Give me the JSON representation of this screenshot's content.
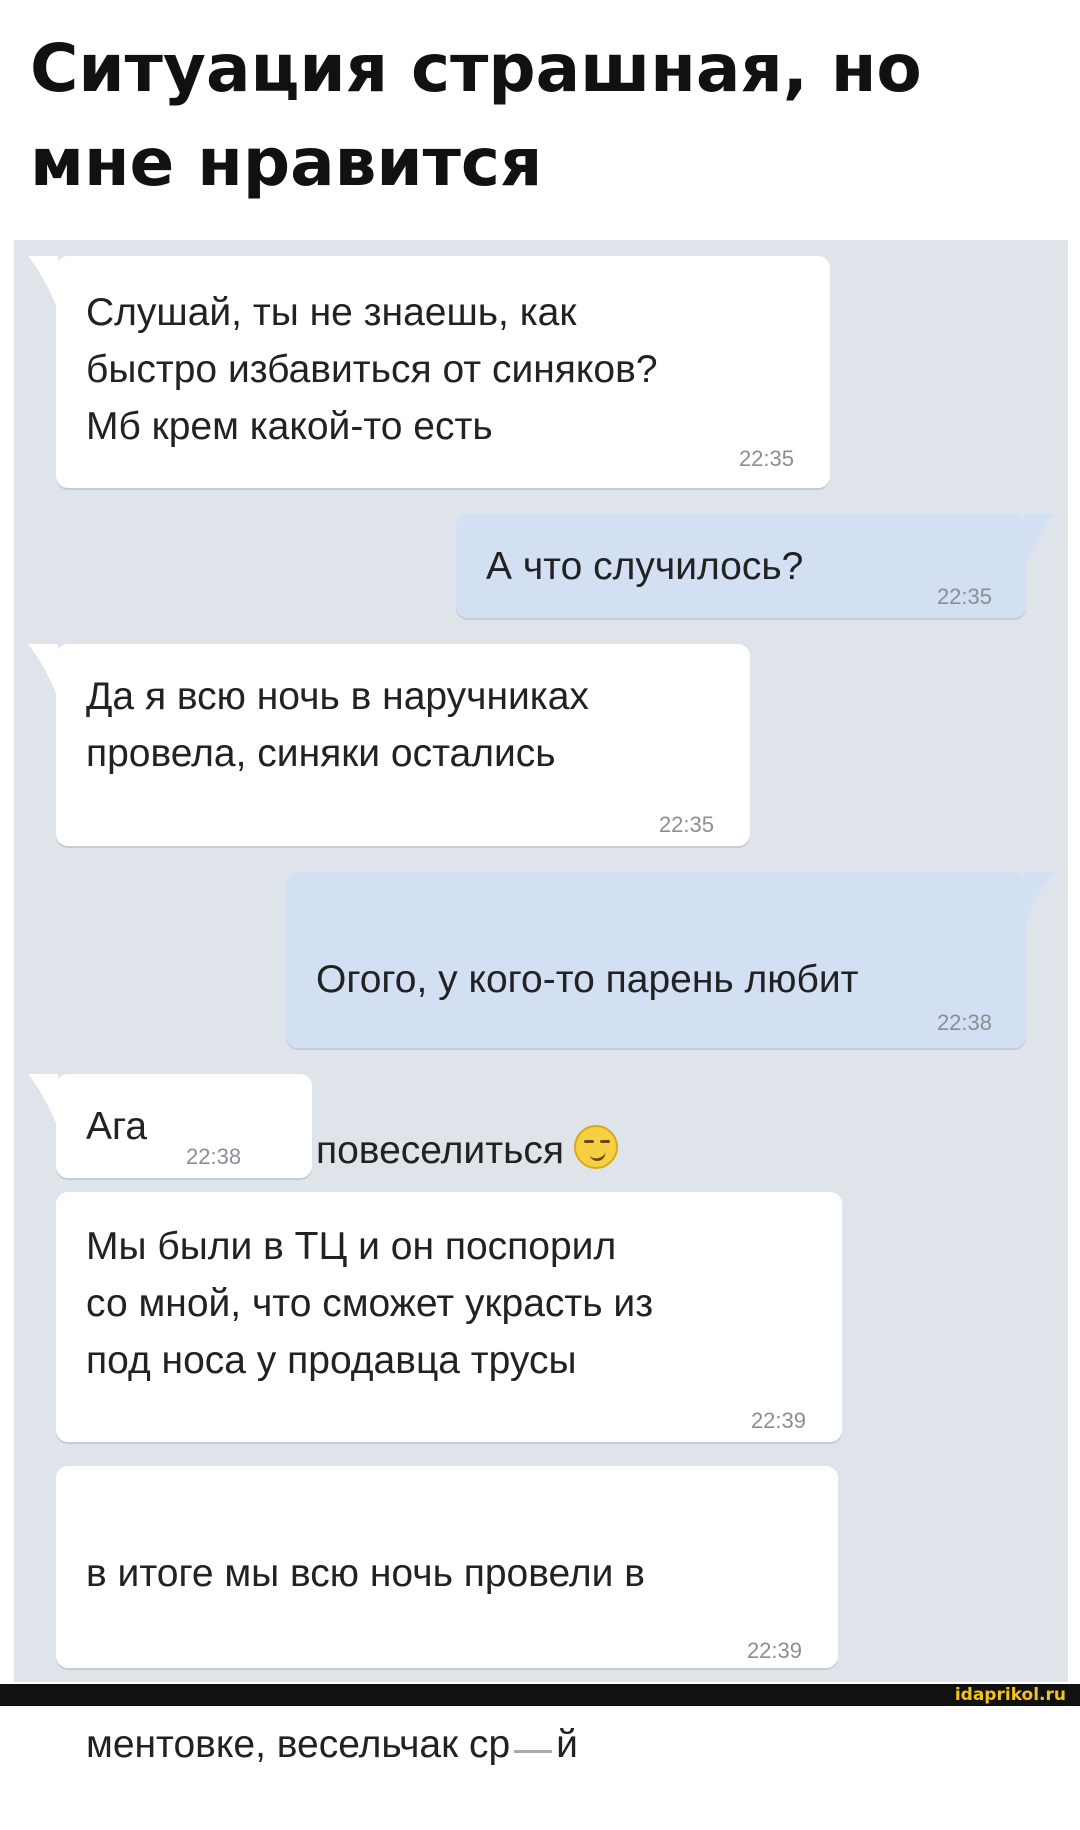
{
  "title": "Ситуация страшная, но мне нравится",
  "messages": [
    {
      "direction": "incoming",
      "text": "Слушай, ты не знаешь, как\nбыстро избавиться от синяков?\nМб крем какой-то есть",
      "time": "22:35"
    },
    {
      "direction": "outgoing",
      "text": "А что случилось?",
      "time": "22:35"
    },
    {
      "direction": "incoming",
      "text": "Да я всю ночь в наручниках\nпровела, синяки остались",
      "time": "22:35"
    },
    {
      "direction": "outgoing",
      "text_line1": "Огого, у кого-то парень любит",
      "text_line2": "повеселиться",
      "emoji": "smirking-face-emoji",
      "time": "22:38"
    },
    {
      "direction": "incoming",
      "text": "Ага",
      "time": "22:38"
    },
    {
      "direction": "incoming",
      "text": "Мы были в ТЦ и он поспорил\nсо мной, что сможет украсть из\nпод носа у продавца трусы",
      "time": "22:39"
    },
    {
      "direction": "incoming",
      "text_line1": "в итоге мы всю ночь провели в",
      "text_line2_before": "ментовке, весельчак ср",
      "text_line2_after": "й",
      "time": "22:39"
    }
  ],
  "colors": {
    "chat_background": "#dfe4ea",
    "incoming_bubble": "#ffffff",
    "outgoing_bubble": "#d3e0f3",
    "timestamp": "#8a8f96",
    "watermark": "#f3c316"
  },
  "watermark": "idaprikol.ru"
}
